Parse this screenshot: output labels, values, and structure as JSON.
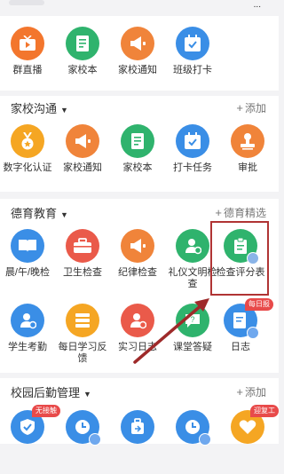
{
  "status": {
    "indicator": "..."
  },
  "top_apps": [
    {
      "label": "群直播",
      "icon": "live-tv-icon",
      "color": "#f3762d"
    },
    {
      "label": "家校本",
      "icon": "notebook-icon",
      "color": "#2fb36d"
    },
    {
      "label": "家校通知",
      "icon": "megaphone-icon",
      "color": "#f0843a"
    },
    {
      "label": "班级打卡",
      "icon": "calendar-check-icon",
      "color": "#3a8ee6"
    }
  ],
  "sections": {
    "home_school": {
      "title": "家校沟通",
      "action": "添加",
      "apps": [
        {
          "label": "数字化认证",
          "icon": "medal-icon",
          "color": "#f5a623"
        },
        {
          "label": "家校通知",
          "icon": "megaphone-icon",
          "color": "#f0843a"
        },
        {
          "label": "家校本",
          "icon": "notebook-icon",
          "color": "#2fb36d"
        },
        {
          "label": "打卡任务",
          "icon": "calendar-check-icon",
          "color": "#3a8ee6"
        },
        {
          "label": "审批",
          "icon": "stamp-icon",
          "color": "#f0843a"
        }
      ]
    },
    "moral_education": {
      "title": "德育教育",
      "action": "德育精选",
      "apps_row1": [
        {
          "label": "晨/午/晚检",
          "icon": "book-open-icon",
          "color": "#3a8ee6"
        },
        {
          "label": "卫生检查",
          "icon": "toolbox-icon",
          "color": "#ea5a4a"
        },
        {
          "label": "纪律检查",
          "icon": "megaphone-icon",
          "color": "#f0843a"
        },
        {
          "label": "礼仪文明检查",
          "icon": "user-refresh-icon",
          "color": "#2fb36d"
        },
        {
          "label": "检查评分表",
          "icon": "clipboard-icon",
          "color": "#2fb36d"
        }
      ],
      "apps_row2": [
        {
          "label": "学生考勤",
          "icon": "user-check-icon",
          "color": "#3a8ee6"
        },
        {
          "label": "每日学习反馈",
          "icon": "stack-icon",
          "color": "#f5a623"
        },
        {
          "label": "实习日志",
          "icon": "user-pin-icon",
          "color": "#ea5a4a"
        },
        {
          "label": "课堂答疑",
          "icon": "question-chat-icon",
          "color": "#2fb36d"
        },
        {
          "label": "日志",
          "icon": "edit-note-icon",
          "color": "#3a8ee6",
          "badge": "每日报"
        }
      ]
    },
    "logistics": {
      "title": "校园后勤管理",
      "action": "添加",
      "apps": [
        {
          "icon": "shield-check-icon",
          "color": "#3a8ee6",
          "badge": "无接触"
        },
        {
          "icon": "clock-icon",
          "color": "#3a8ee6"
        },
        {
          "icon": "suitcase-icon",
          "color": "#3a8ee6"
        },
        {
          "icon": "clock-icon",
          "color": "#3a8ee6"
        },
        {
          "icon": "heart-icon",
          "color": "#f5a623",
          "badge": "迎复工"
        }
      ]
    }
  }
}
